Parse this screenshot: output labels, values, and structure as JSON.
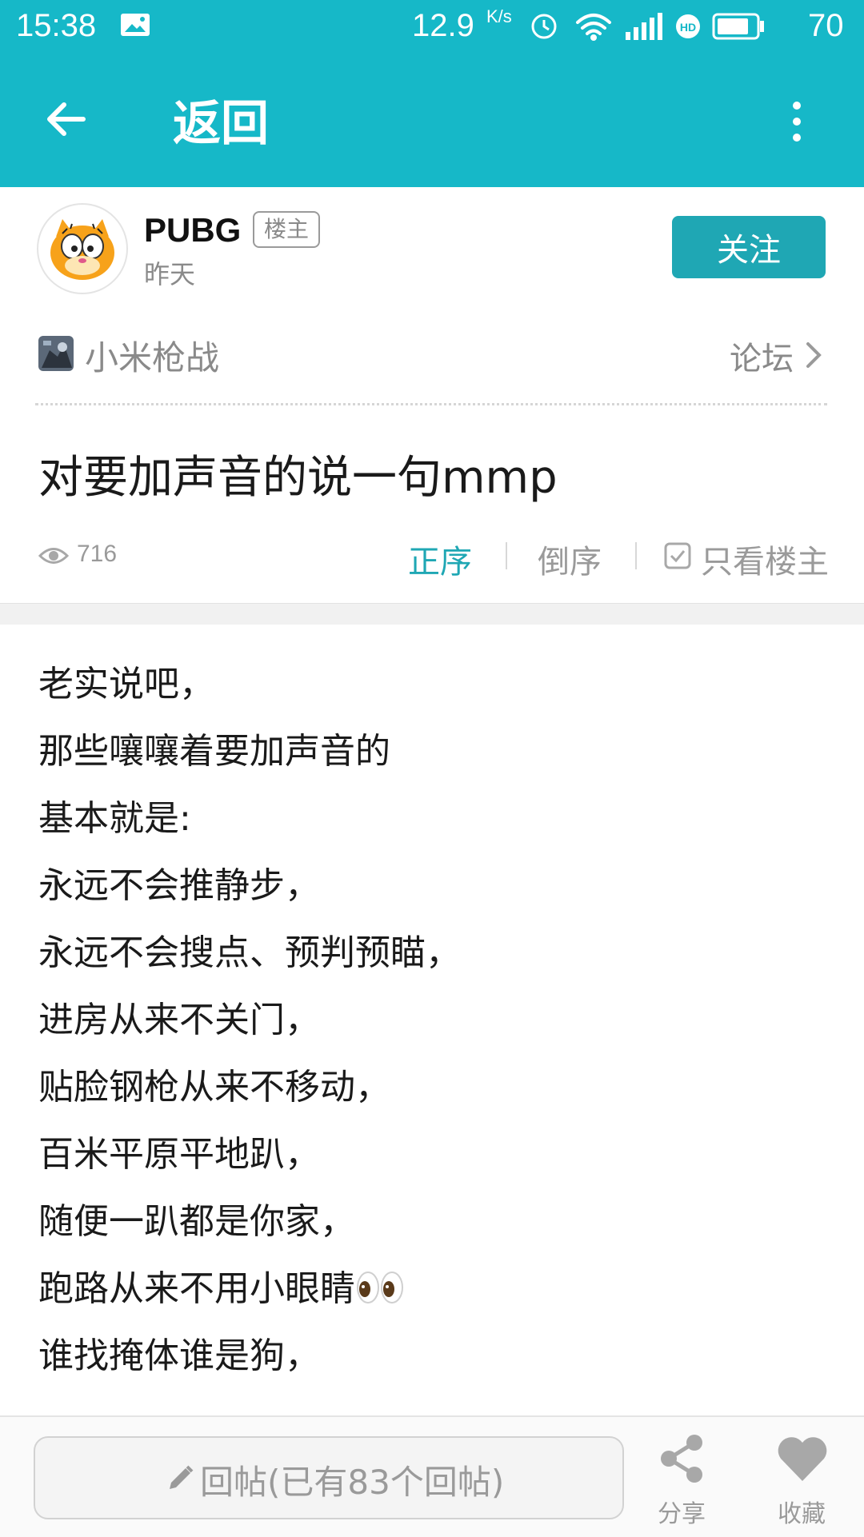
{
  "status_bar": {
    "time": "15:38",
    "speed": "12.9",
    "speed_unit": "K/s",
    "battery": "70",
    "icons": [
      "image-icon",
      "alarm-icon",
      "wifi-icon",
      "4g-signal-icon",
      "hd-icon",
      "battery-icon"
    ]
  },
  "app_bar": {
    "title": "返回",
    "back_icon": "arrow-left-icon",
    "menu_icon": "more-vertical-icon"
  },
  "author": {
    "name": "PUBG",
    "badge": "楼主",
    "time": "昨天",
    "follow_label": "关注"
  },
  "forum": {
    "name": "小米枪战",
    "link": "论坛"
  },
  "post": {
    "title": "对要加声音的说一句mmp",
    "views": "716",
    "sort_asc": "正序",
    "sort_desc": "倒序",
    "only_op": "只看楼主",
    "lines": [
      "老实说吧，",
      "那些嚷嚷着要加声音的",
      "基本就是:",
      "永远不会推静步，",
      "永远不会搜点、预判预瞄，",
      "进房从来不关门，",
      "贴脸钢枪从来不移动，",
      "百米平原平地趴，",
      "随便一趴都是你家，",
      "跑路从来不用小眼睛",
      "谁找掩体谁是狗，"
    ]
  },
  "bottom_bar": {
    "reply_placeholder": "回帖(已有83个回帖)",
    "share_label": "分享",
    "favorite_label": "收藏"
  },
  "colors": {
    "primary": "#16b8c8",
    "button": "#1fa7b4",
    "muted": "#9a9a9a"
  }
}
